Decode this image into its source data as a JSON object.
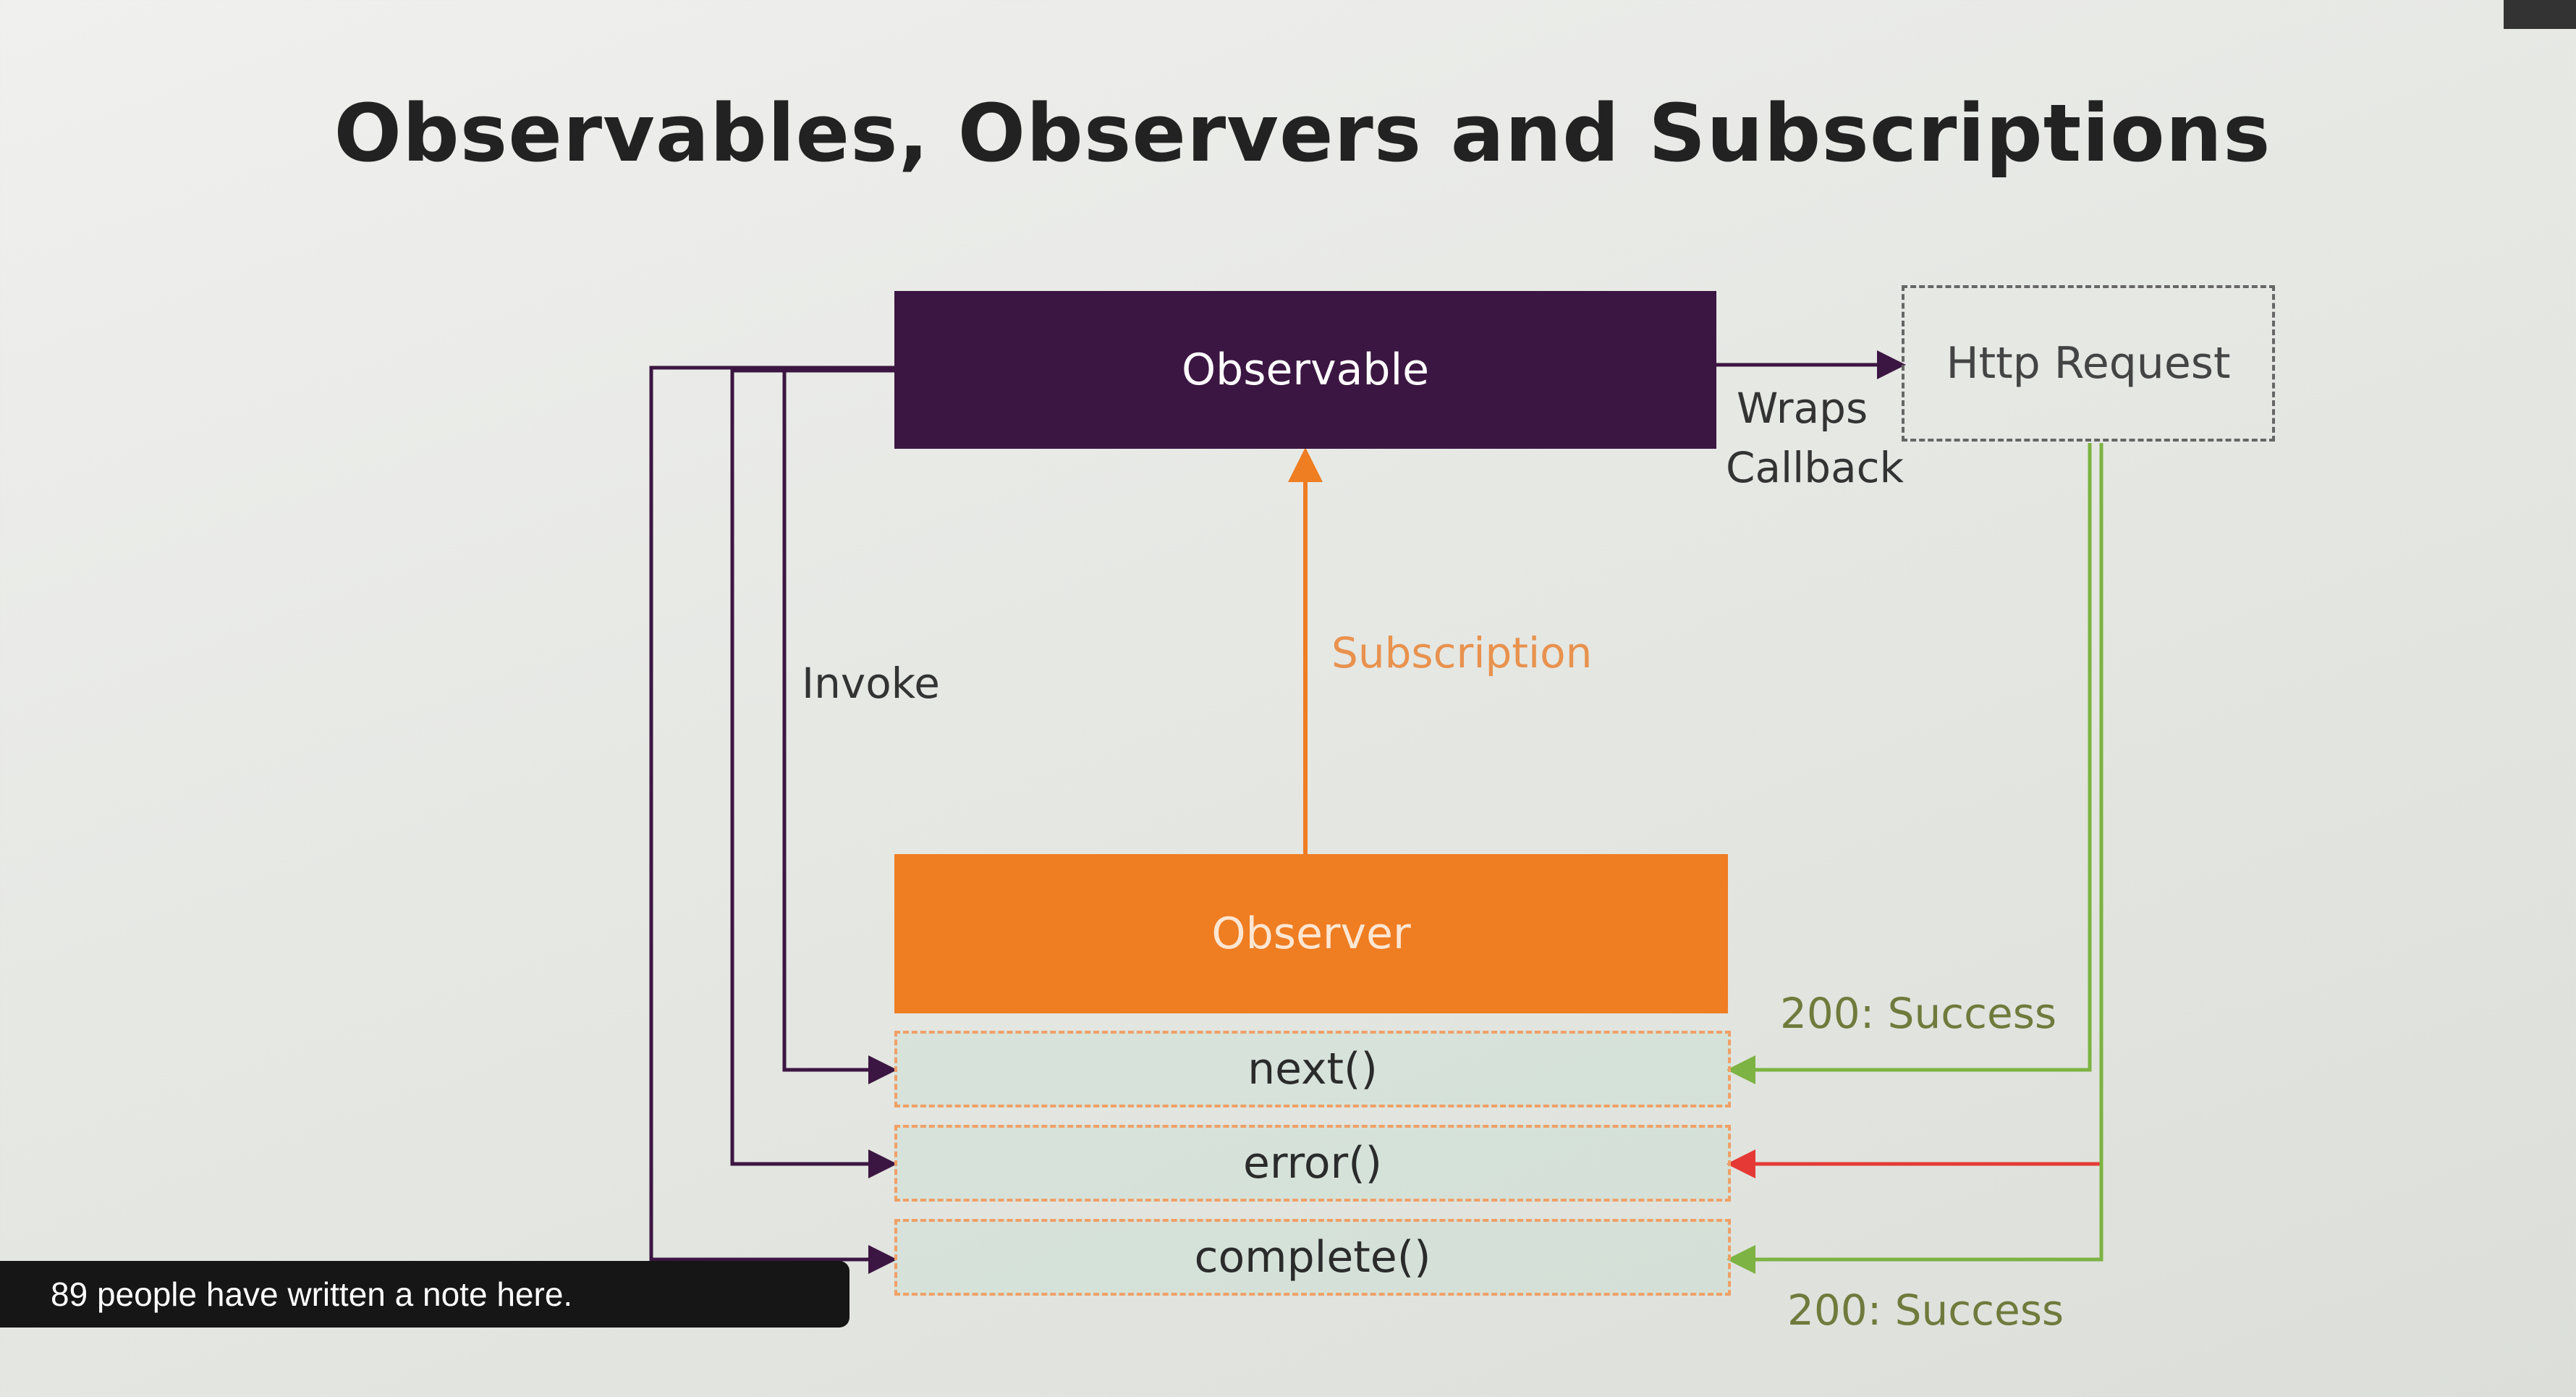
{
  "title": "Observables, Observers and Subscriptions",
  "boxes": {
    "observable": "Observable",
    "http_request": "Http Request",
    "observer": "Observer",
    "next": "next()",
    "error": "error()",
    "complete": "complete()"
  },
  "labels": {
    "wraps": "Wraps",
    "callback": "Callback",
    "invoke": "Invoke",
    "subscription": "Subscription",
    "success_top": "200: Success",
    "success_bottom": "200: Success"
  },
  "note_banner": "89 people have written a note here.",
  "colors": {
    "observable": "#3c1642",
    "observer": "#ef7d22",
    "success_arrow": "#7cb342",
    "error_arrow": "#e53935",
    "subscription_arrow": "#ef7d22",
    "invoke_lines": "#3c1642"
  }
}
